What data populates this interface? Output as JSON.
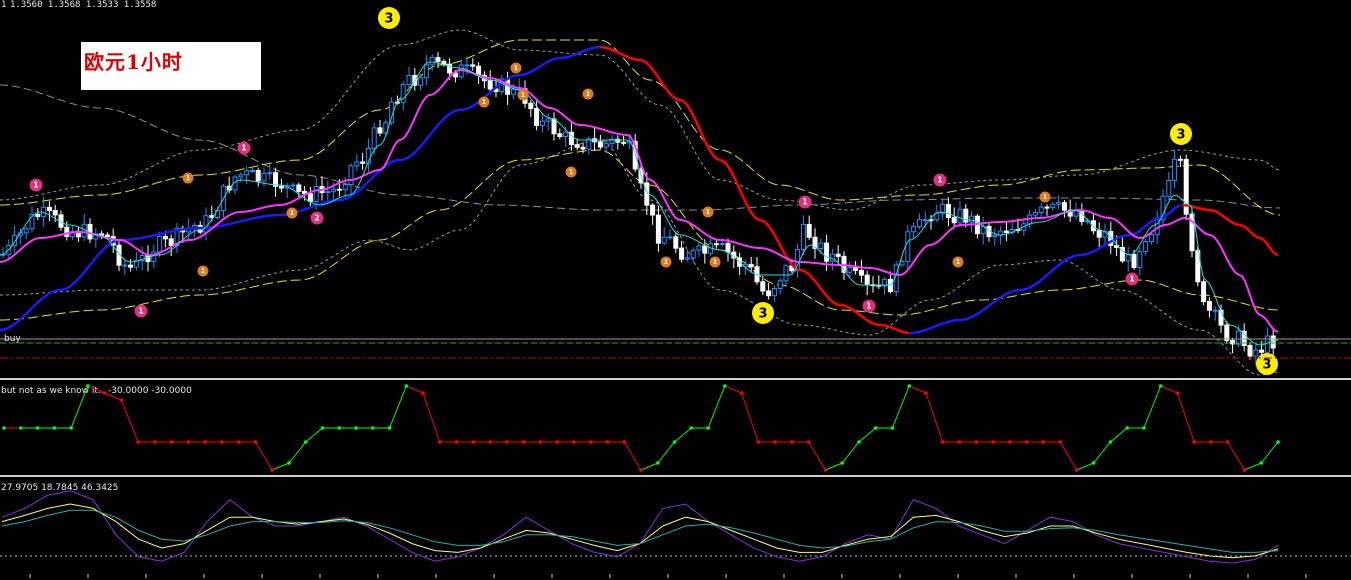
{
  "header": {
    "main_ohlc": "1.3560 1.3568 1.3533 1.3558",
    "main_period_fragment": "1",
    "sub1_label": "but not as we know it...",
    "sub1_values": "-30.0000 -30.0000",
    "sub2_values": "27.9705 18.7845 46.3425",
    "buy_label": "buy"
  },
  "title_label": "欧元1小时",
  "marker_big": "3",
  "marker_small": [
    "1",
    "2"
  ],
  "colors": {
    "background": "#000000",
    "bull_candle": "#1e90ff",
    "bear_candle": "#ffffff",
    "ma_slow_blue": "#1a1aff",
    "ma_slow_red": "#ff0000",
    "ma_fast_magenta": "#ff33ff",
    "ma_fastest_cyan": "#20e0e0",
    "band_yellow": "#e6e600",
    "band_gray": "#9a9a9a",
    "buy_line": "#00c000",
    "sell_line": "#d00000",
    "osc_up": "#00ff00",
    "osc_down": "#ff0000",
    "stoch_purple": "#8a2be2",
    "stoch_yellow": "#ffff66",
    "stoch_cyan": "#20b2aa",
    "marker_yellow": "#ffee00",
    "marker_orange": "#e07b1e",
    "marker_pink": "#e0307a"
  },
  "chart_data": [
    {
      "type": "candlestick",
      "description_indicators": [
        "blue/red slow MA",
        "magenta MA",
        "cyan MA",
        "yellow dashed bands",
        "gray dashed bands"
      ],
      "x_index_range": [
        0,
        220
      ],
      "closes_estimated": [
        1.3592,
        1.361,
        1.3625,
        1.3615,
        1.3605,
        1.36,
        1.361,
        1.3605,
        1.359,
        1.3575,
        1.357,
        1.358,
        1.36,
        1.362,
        1.364,
        1.365,
        1.3655,
        1.365,
        1.364,
        1.363,
        1.366,
        1.369,
        1.372,
        1.3735,
        1.374,
        1.3745,
        1.374,
        1.373,
        1.3725,
        1.3715,
        1.37,
        1.369,
        1.3685,
        1.3675,
        1.368,
        1.3665,
        1.364,
        1.362,
        1.36,
        1.359,
        1.36,
        1.3585,
        1.3575,
        1.3565,
        1.356,
        1.358,
        1.36,
        1.362,
        1.363,
        1.3635,
        1.364,
        1.365,
        1.3645,
        1.3655,
        1.365,
        1.364,
        1.3625,
        1.36,
        1.359,
        1.3575,
        1.356,
        1.355,
        1.3545,
        1.354,
        1.3545,
        1.3558
      ]
    },
    {
      "type": "line",
      "name": "but not as we know it...",
      "ylim": [
        -30,
        30
      ],
      "values_estimated": [
        0,
        0,
        0,
        0,
        0,
        30,
        25,
        20,
        -10,
        -10,
        -10,
        -10,
        -10,
        -10,
        -10,
        -10,
        -30,
        -25,
        -10,
        0,
        0,
        0,
        0,
        0,
        30,
        25,
        -10,
        -10,
        -10,
        -10,
        -10,
        -10,
        -10,
        -10,
        -10,
        -10,
        -10,
        -10,
        -30,
        -25,
        -10,
        0,
        0,
        30,
        25,
        -10,
        -10,
        -10,
        -10,
        -30,
        -25,
        -10,
        0,
        0,
        30,
        25,
        -10,
        -10,
        -10,
        -10,
        -10,
        -10,
        -10,
        -10,
        -30,
        -25,
        -10,
        0,
        0,
        30,
        25,
        -10,
        -10,
        -10,
        -30,
        -25,
        -10
      ]
    },
    {
      "type": "line",
      "name": "stochastic",
      "ylim": [
        0,
        100
      ],
      "series": [
        {
          "values": [
            60,
            70,
            85,
            90,
            80,
            40,
            15,
            10,
            20,
            55,
            80,
            60,
            50,
            50,
            55,
            60,
            50,
            35,
            20,
            10,
            15,
            25,
            40,
            60,
            45,
            30,
            20,
            15,
            30,
            70,
            75,
            55,
            40,
            25,
            15,
            10,
            15,
            30,
            40,
            35,
            80,
            70,
            50,
            40,
            30,
            45,
            60,
            55,
            40,
            30,
            25,
            20,
            15,
            10,
            8,
            12,
            28
          ]
        },
        {
          "values": [
            55,
            62,
            70,
            75,
            70,
            55,
            35,
            25,
            30,
            45,
            60,
            60,
            55,
            52,
            55,
            58,
            52,
            42,
            30,
            22,
            20,
            25,
            35,
            45,
            42,
            35,
            28,
            22,
            30,
            50,
            60,
            55,
            45,
            35,
            25,
            20,
            20,
            28,
            35,
            38,
            60,
            62,
            55,
            45,
            38,
            42,
            50,
            50,
            42,
            35,
            30,
            25,
            20,
            16,
            14,
            16,
            24
          ]
        },
        {
          "values": [
            50,
            55,
            62,
            68,
            68,
            60,
            45,
            35,
            33,
            40,
            50,
            55,
            55,
            54,
            54,
            56,
            54,
            48,
            40,
            32,
            28,
            28,
            32,
            40,
            40,
            38,
            33,
            28,
            30,
            40,
            50,
            52,
            48,
            42,
            35,
            28,
            25,
            27,
            32,
            35,
            48,
            55,
            54,
            50,
            44,
            44,
            47,
            48,
            45,
            40,
            36,
            32,
            28,
            24,
            20,
            20,
            22
          ]
        }
      ]
    }
  ]
}
